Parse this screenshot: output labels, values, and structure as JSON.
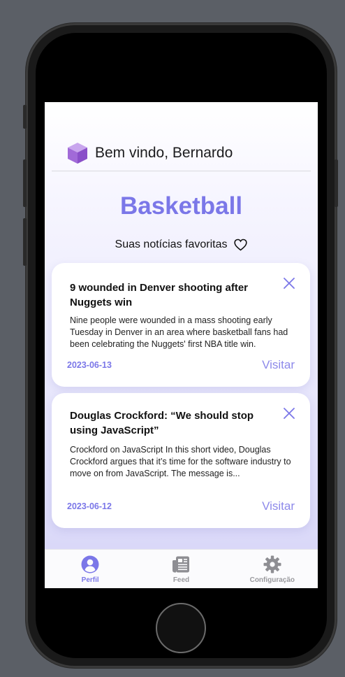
{
  "header": {
    "greeting": "Bem vindo, Bernardo",
    "logo_icon": "cube-icon"
  },
  "page": {
    "title": "Basketball",
    "subtitle": "Suas notícias favoritas",
    "subtitle_icon": "heart-icon"
  },
  "news": [
    {
      "title": "9 wounded in Denver shooting after Nuggets win",
      "description": "Nine people were wounded in a mass shooting early Tuesday in Denver in an area where basketball fans had been celebrating the Nuggets' first NBA title win.",
      "date": "2023-06-13",
      "visit_label": "Visitar"
    },
    {
      "title": "Douglas Crockford: “We should stop using JavaScript”",
      "description": "Crockford on JavaScript In this short video, Douglas Crockford argues that it’s time for the software industry to move on from JavaScript. The message is...",
      "date": "2023-06-12",
      "visit_label": "Visitar"
    }
  ],
  "tabbar": {
    "items": [
      {
        "label": "Perfil",
        "icon": "profile-icon",
        "active": true
      },
      {
        "label": "Feed",
        "icon": "newspaper-icon",
        "active": false
      },
      {
        "label": "Configuração",
        "icon": "gear-icon",
        "active": false
      }
    ]
  },
  "colors": {
    "accent": "#7b77e8",
    "inactive": "#9a9a9e"
  }
}
